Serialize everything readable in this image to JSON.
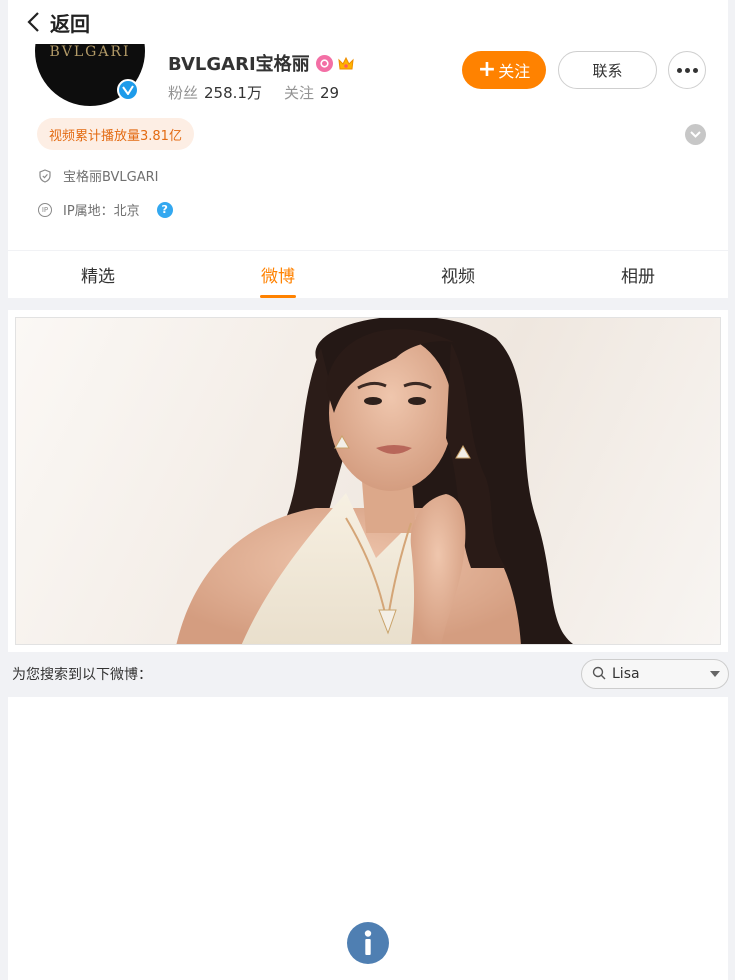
{
  "nav": {
    "back_label": "返回"
  },
  "profile": {
    "avatar_text": "BVLGARI",
    "name": "BVLGARI宝格丽",
    "stats": [
      {
        "label": "粉丝",
        "value": "258.1万"
      },
      {
        "label": "关注",
        "value": "29"
      }
    ],
    "actions": {
      "follow_label": "关注",
      "contact_label": "联系"
    },
    "play_count": "视频累计播放量3.81亿",
    "verify_text": "宝格丽BVLGARI",
    "ip_icon_text": "IP",
    "ip_location": "IP属地：北京",
    "help_mark": "?"
  },
  "tabs": [
    {
      "label": "精选",
      "active": false
    },
    {
      "label": "微博",
      "active": true
    },
    {
      "label": "视频",
      "active": false
    },
    {
      "label": "相册",
      "active": false
    }
  ],
  "search": {
    "result_text": "为您搜索到以下微博：",
    "keyword": "Lisa"
  },
  "colors": {
    "accent": "#ff8200",
    "verified_blue": "#1d9bea",
    "pill_bg": "#fdeee4",
    "pill_text": "#e36b13",
    "info_blue": "#4f7fb2"
  },
  "icons": [
    "chevron-left-icon",
    "verified-icon",
    "fan-badge-icon",
    "crown-icon",
    "more-icon",
    "chevron-down-icon",
    "shield-icon",
    "ip-icon",
    "help-icon",
    "search-icon",
    "info-icon"
  ]
}
